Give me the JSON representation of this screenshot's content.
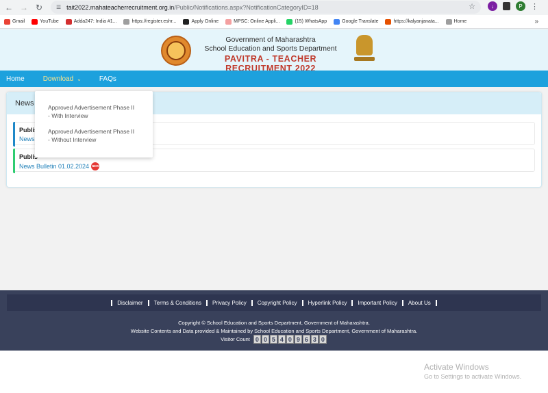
{
  "browser": {
    "url_host": "tait2022.mahateacherrecruitment.org.in",
    "url_path": "/Public/Notifications.aspx?NotificationCategoryID=18",
    "profile_initial": "P",
    "bookmarks": [
      {
        "label": "Gmail",
        "color": "#ea4335"
      },
      {
        "label": "YouTube",
        "color": "#ff0000"
      },
      {
        "label": "Adda247: India #1...",
        "color": "#d32f2f"
      },
      {
        "label": "https://register.eshr...",
        "color": "#9e9e9e"
      },
      {
        "label": "Apply Online",
        "color": "#212121"
      },
      {
        "label": "MPSC: Online Appli...",
        "color": "#f4a0a0"
      },
      {
        "label": "(15) WhatsApp",
        "color": "#25d366"
      },
      {
        "label": "Google Translate",
        "color": "#4285f4"
      },
      {
        "label": "https://kalyanjanata...",
        "color": "#e65100"
      },
      {
        "label": "Home",
        "color": "#9e9e9e"
      }
    ]
  },
  "header": {
    "line1": "Government of Maharashtra",
    "line2": "School Education and Sports Department",
    "line3": "PAVITRA - TEACHER RECRUITMENT 2022"
  },
  "nav": {
    "home": "Home",
    "download": "Download",
    "faqs": "FAQs"
  },
  "dropdown": {
    "items": [
      {
        "line1": "Approved Advertisement Phase II",
        "line2": "- With Interview"
      },
      {
        "line1": "Approved Advertisement Phase II",
        "line2": "- Without Interview"
      }
    ]
  },
  "news": {
    "heading": "News",
    "items": [
      {
        "title": "Publis",
        "link": "News",
        "accent": "#1e88c8"
      },
      {
        "title": "Publis",
        "link": "News Bulletin 01.02.2024",
        "badge": "NEW",
        "accent": "#2ecc71"
      }
    ]
  },
  "footer": {
    "links": [
      "Disclaimer",
      "Terms & Conditions",
      "Privacy Policy",
      "Copyright Policy",
      "Hyperlink Policy",
      "Important Policy",
      "About Us"
    ],
    "copyright": "Copyright © School Education and Sports Department, Government of Maharashtra.",
    "maintained": "Website Contents and Data provided & Maintained by School Education and Sports Department, Government of Maharashtra.",
    "visitor_label": "Visitor Count",
    "visitor_digits": [
      "0",
      "0",
      "5",
      "4",
      "0",
      "9",
      "6",
      "3",
      "0"
    ]
  },
  "os_watermark": {
    "line1": "Activate Windows",
    "line2": "Go to Settings to activate Windows."
  }
}
